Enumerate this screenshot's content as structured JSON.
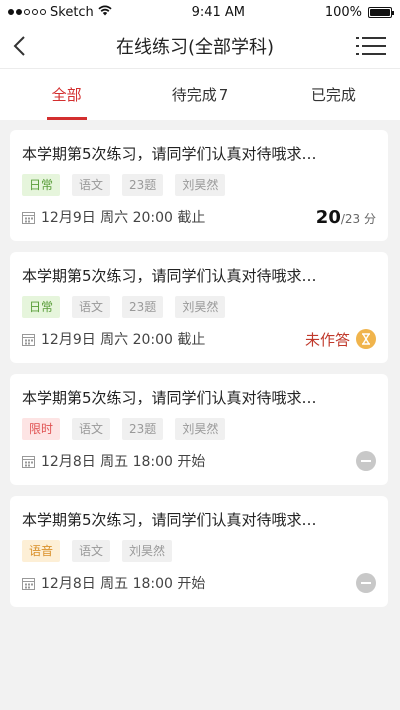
{
  "status_bar": {
    "carrier": "Sketch",
    "time": "9:41 AM",
    "battery": "100%"
  },
  "nav": {
    "title": "在线练习(全部学科)",
    "back_icon": "back-icon",
    "menu_icon": "menu-icon"
  },
  "tabs": [
    {
      "label": "全部",
      "count": "",
      "active": true
    },
    {
      "label": "待完成",
      "count": "7",
      "active": false
    },
    {
      "label": "已完成",
      "count": "",
      "active": false
    }
  ],
  "cards": [
    {
      "title": "本学期第5次练习，请同学们认真对待哦求…",
      "tags": [
        {
          "text": "日常",
          "style": "green"
        },
        {
          "text": "语文",
          "style": "gray"
        },
        {
          "text": "23题",
          "style": "gray"
        },
        {
          "text": "刘昊然",
          "style": "gray"
        }
      ],
      "date": "12月9日 周六 20:00 截止",
      "score": "20",
      "total": "/23 分"
    },
    {
      "title": "本学期第5次练习，请同学们认真对待哦求…",
      "tags": [
        {
          "text": "日常",
          "style": "green"
        },
        {
          "text": "语文",
          "style": "gray"
        },
        {
          "text": "23题",
          "style": "gray"
        },
        {
          "text": "刘昊然",
          "style": "gray"
        }
      ],
      "date": "12月9日 周六 20:00 截止",
      "status": "未作答"
    },
    {
      "title": "本学期第5次练习，请同学们认真对待哦求…",
      "tags": [
        {
          "text": "限时",
          "style": "red"
        },
        {
          "text": "语文",
          "style": "gray"
        },
        {
          "text": "23题",
          "style": "gray"
        },
        {
          "text": "刘昊然",
          "style": "gray"
        }
      ],
      "date": "12月8日 周五 18:00 开始"
    },
    {
      "title": "本学期第5次练习，请同学们认真对待哦求…",
      "tags": [
        {
          "text": "语音",
          "style": "orange"
        },
        {
          "text": "语文",
          "style": "gray"
        },
        {
          "text": "刘昊然",
          "style": "gray"
        }
      ],
      "date": "12月8日 周五 18:00 开始"
    }
  ],
  "colors": {
    "accent": "#d32f2f",
    "background": "#f2f2f2"
  }
}
